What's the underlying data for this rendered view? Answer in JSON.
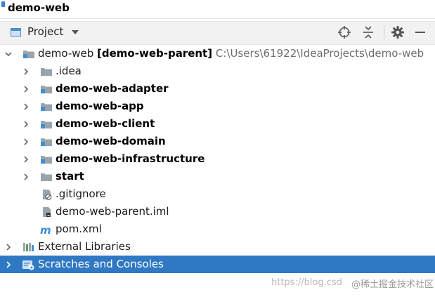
{
  "window": {
    "title": "demo-web"
  },
  "toolbar": {
    "view_label": "Project",
    "icons": [
      "locate-icon",
      "collapse-all-icon",
      "gear-icon",
      "minimize-icon"
    ]
  },
  "tree": {
    "root": {
      "name": "demo-web",
      "module": "[demo-web-parent]",
      "path": "C:\\Users\\61922\\IdeaProjects\\demo-web"
    },
    "children": [
      {
        "label": ".idea",
        "type": "folder",
        "expanded": false
      },
      {
        "label": "demo-web-adapter",
        "type": "module",
        "expanded": false
      },
      {
        "label": "demo-web-app",
        "type": "module",
        "expanded": false
      },
      {
        "label": "demo-web-client",
        "type": "module",
        "expanded": false
      },
      {
        "label": "demo-web-domain",
        "type": "module",
        "expanded": false
      },
      {
        "label": "demo-web-infrastructure",
        "type": "module",
        "expanded": false
      },
      {
        "label": "start",
        "type": "module",
        "expanded": false
      },
      {
        "label": ".gitignore",
        "type": "file"
      },
      {
        "label": "demo-web-parent.iml",
        "type": "file"
      },
      {
        "label": "pom.xml",
        "type": "maven-file"
      }
    ],
    "external_libraries": "External Libraries",
    "scratches": "Scratches and Consoles"
  },
  "watermark": {
    "url": "https://blog.csd",
    "site": "@稀土掘金技术社区"
  },
  "colors": {
    "selection": "#2f78c4",
    "folder": "#9aa4ad",
    "module_badge": "#3e8fd6",
    "toolbar_bg": "#f2f2f2"
  }
}
